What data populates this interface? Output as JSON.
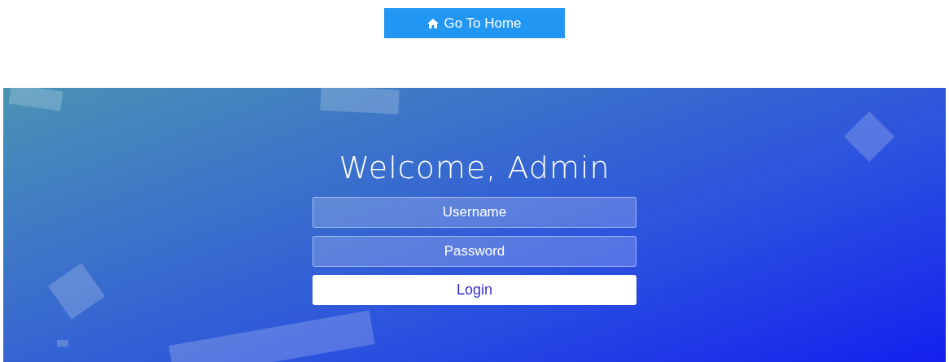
{
  "home_button": {
    "label": "Go To Home"
  },
  "login": {
    "title": "Welcome, Admin",
    "fields": [
      {
        "placeholder": "Username"
      },
      {
        "placeholder": "Password"
      }
    ],
    "submit": "Login"
  }
}
